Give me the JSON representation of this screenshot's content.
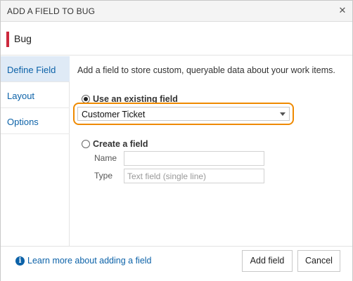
{
  "dialog": {
    "title": "ADD A FIELD TO BUG",
    "close_glyph": "✕",
    "work_item_type": "Bug",
    "work_item_color": "#cc293d"
  },
  "nav": {
    "items": [
      {
        "label": "Define Field",
        "selected": true
      },
      {
        "label": "Layout",
        "selected": false
      },
      {
        "label": "Options",
        "selected": false
      }
    ]
  },
  "main": {
    "intro": "Add a field to store custom, queryable data about your work items.",
    "use_existing": {
      "label": "Use an existing field",
      "selected": true
    },
    "existing_field_value": "Customer Ticket",
    "create_field": {
      "label": "Create a field",
      "selected": false
    },
    "name_label": "Name",
    "name_value": "",
    "type_label": "Type",
    "type_value": "Text field (single line)"
  },
  "footer": {
    "learn_more": "Learn more about adding a field",
    "add_button": "Add field",
    "cancel_button": "Cancel"
  },
  "colors": {
    "accent": "#0c62a8",
    "highlight": "#ef8a00",
    "nav_selected": "#dfeaf6"
  }
}
